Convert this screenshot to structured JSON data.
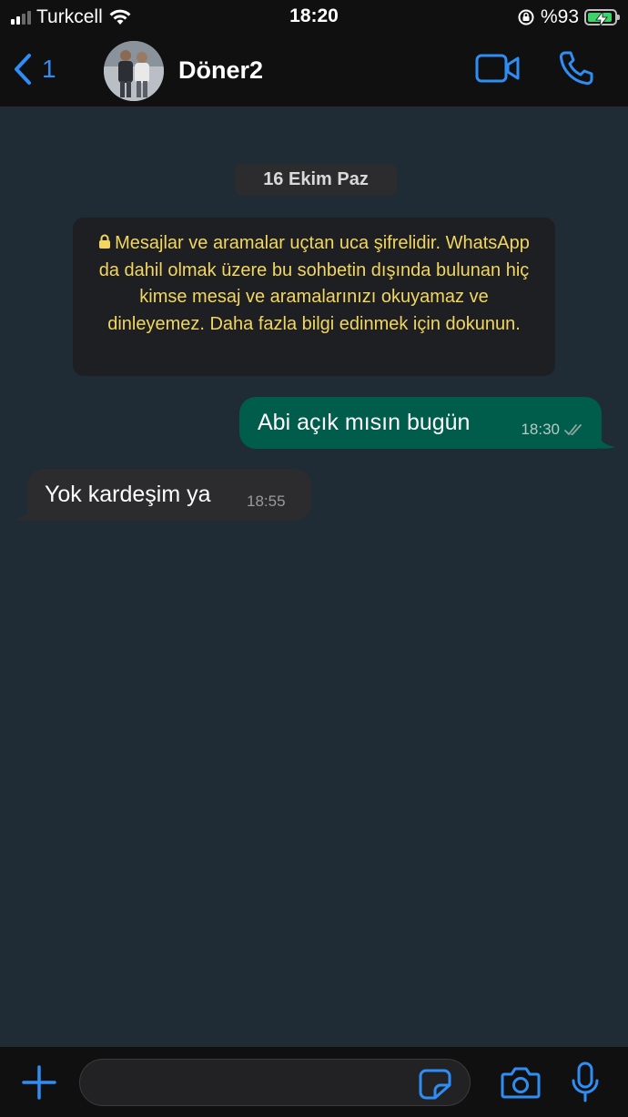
{
  "status_bar": {
    "carrier": "Turkcell",
    "time": "18:20",
    "battery_text": "%93",
    "battery_level": 0.93,
    "icons": [
      "signal-icon",
      "wifi-icon",
      "orientation-lock-icon",
      "battery-charging-icon"
    ]
  },
  "header": {
    "back_count": "1",
    "contact_name": "Döner2",
    "icons": [
      "chevron-left-icon",
      "video-call-icon",
      "phone-icon"
    ]
  },
  "chat": {
    "date_label": "16 Ekim Paz",
    "encryption_notice": "Mesajlar ve aramalar uçtan uca şifrelidir. WhatsApp da dahil olmak üzere bu sohbetin dışında bulunan hiç kimse mesaj ve aramalarınızı okuyamaz ve dinleyemez. Daha fazla bilgi edinmek için dokunun.",
    "messages": [
      {
        "direction": "outgoing",
        "text": "Abi açık mısın bugün",
        "time": "18:30",
        "status": "read"
      },
      {
        "direction": "incoming",
        "text": "Yok kardeşim ya",
        "time": "18:55"
      }
    ]
  },
  "composer": {
    "placeholder": "",
    "icons": [
      "plus-icon",
      "sticker-icon",
      "camera-icon",
      "microphone-icon"
    ]
  },
  "colors": {
    "accent": "#2f8ef5",
    "outgoing_bubble": "#005c4b",
    "incoming_bubble": "#2c2c2e",
    "chat_background": "#1f2b35",
    "notice_text": "#f2d65f",
    "battery_fill": "#3ed36a"
  }
}
